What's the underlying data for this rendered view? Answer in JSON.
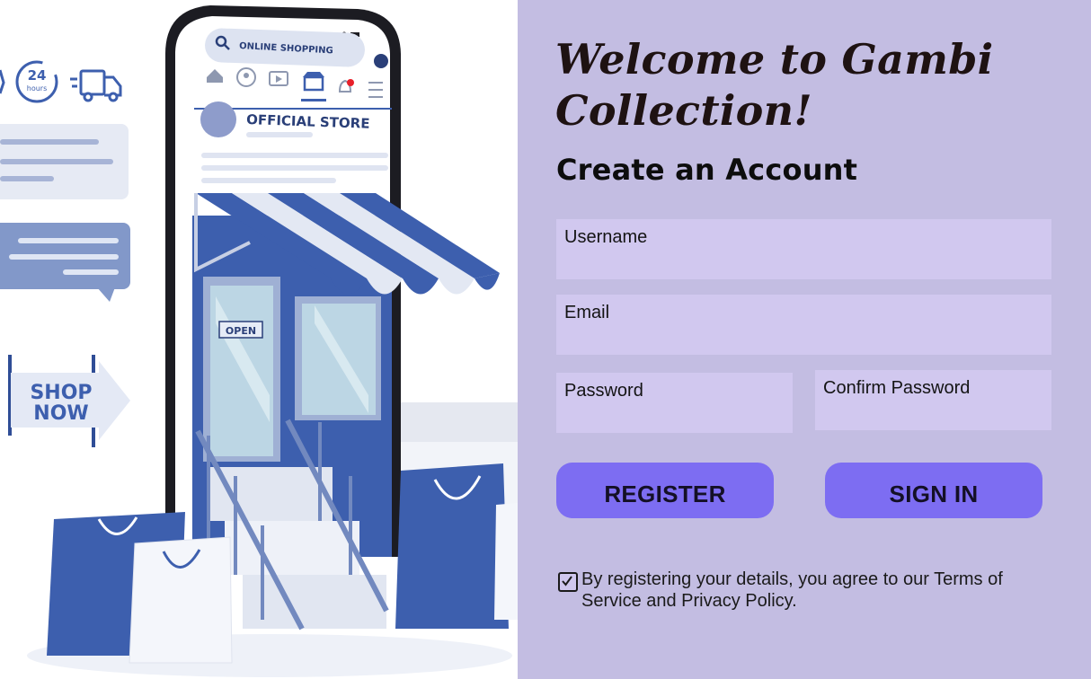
{
  "form": {
    "welcome_title": "Welcome to Gambi Collection!",
    "heading": "Create an Account",
    "fields": {
      "username": "Username",
      "email": "Email",
      "password": "Password",
      "confirm_password": "Confirm Password"
    },
    "register_label": "REGISTER",
    "signin_label": "SIGN IN",
    "terms_checked": true,
    "terms_text": "By registering your details, you agree to our Terms of Service and Privacy Policy."
  },
  "illustration": {
    "search_text": "ONLINE SHOPPING",
    "store_name": "OFFICIAL STORE",
    "open_sign": "OPEN",
    "hours_number": "24",
    "hours_word": "hours",
    "shop_line1": "SHOP",
    "shop_line2": "NOW"
  },
  "colors": {
    "panel_bg": "#c3bde2",
    "field_bg": "#d1c8ef",
    "button_bg": "#7d6df2",
    "illustration_blue": "#3d5fae"
  }
}
